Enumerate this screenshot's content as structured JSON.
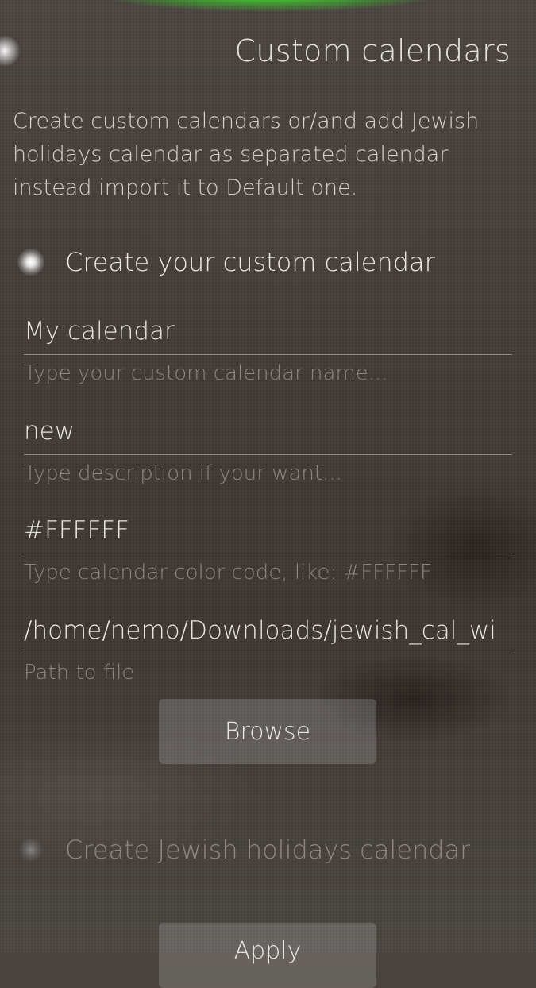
{
  "header": {
    "title": "Custom calendars"
  },
  "intro": {
    "text": "Create custom calendars or/and add Jewish holidays calendar as separated calendar instead import it to Default one."
  },
  "custom_calendar": {
    "switch_label": "Create your custom calendar",
    "switch_checked": true,
    "name_field": {
      "value": "My calendar",
      "placeholder": "Type your custom calendar name..."
    },
    "description_field": {
      "value": "new",
      "placeholder": "Type description if your want..."
    },
    "color_field": {
      "value": "#FFFFFF",
      "placeholder": "Type calendar color code, like: #FFFFFF"
    },
    "path_field": {
      "value": "/home/nemo/Downloads/jewish_cal_wi",
      "placeholder": "Path to file"
    },
    "browse_label": "Browse"
  },
  "jewish_calendar": {
    "switch_label": "Create Jewish holidays calendar",
    "switch_checked": false
  },
  "apply_label": "Apply",
  "colors": {
    "background": "#433d39",
    "accent_glow": "#50ff3c",
    "hint_text": "#8c857e",
    "primary_text": "#e9e5e0"
  }
}
